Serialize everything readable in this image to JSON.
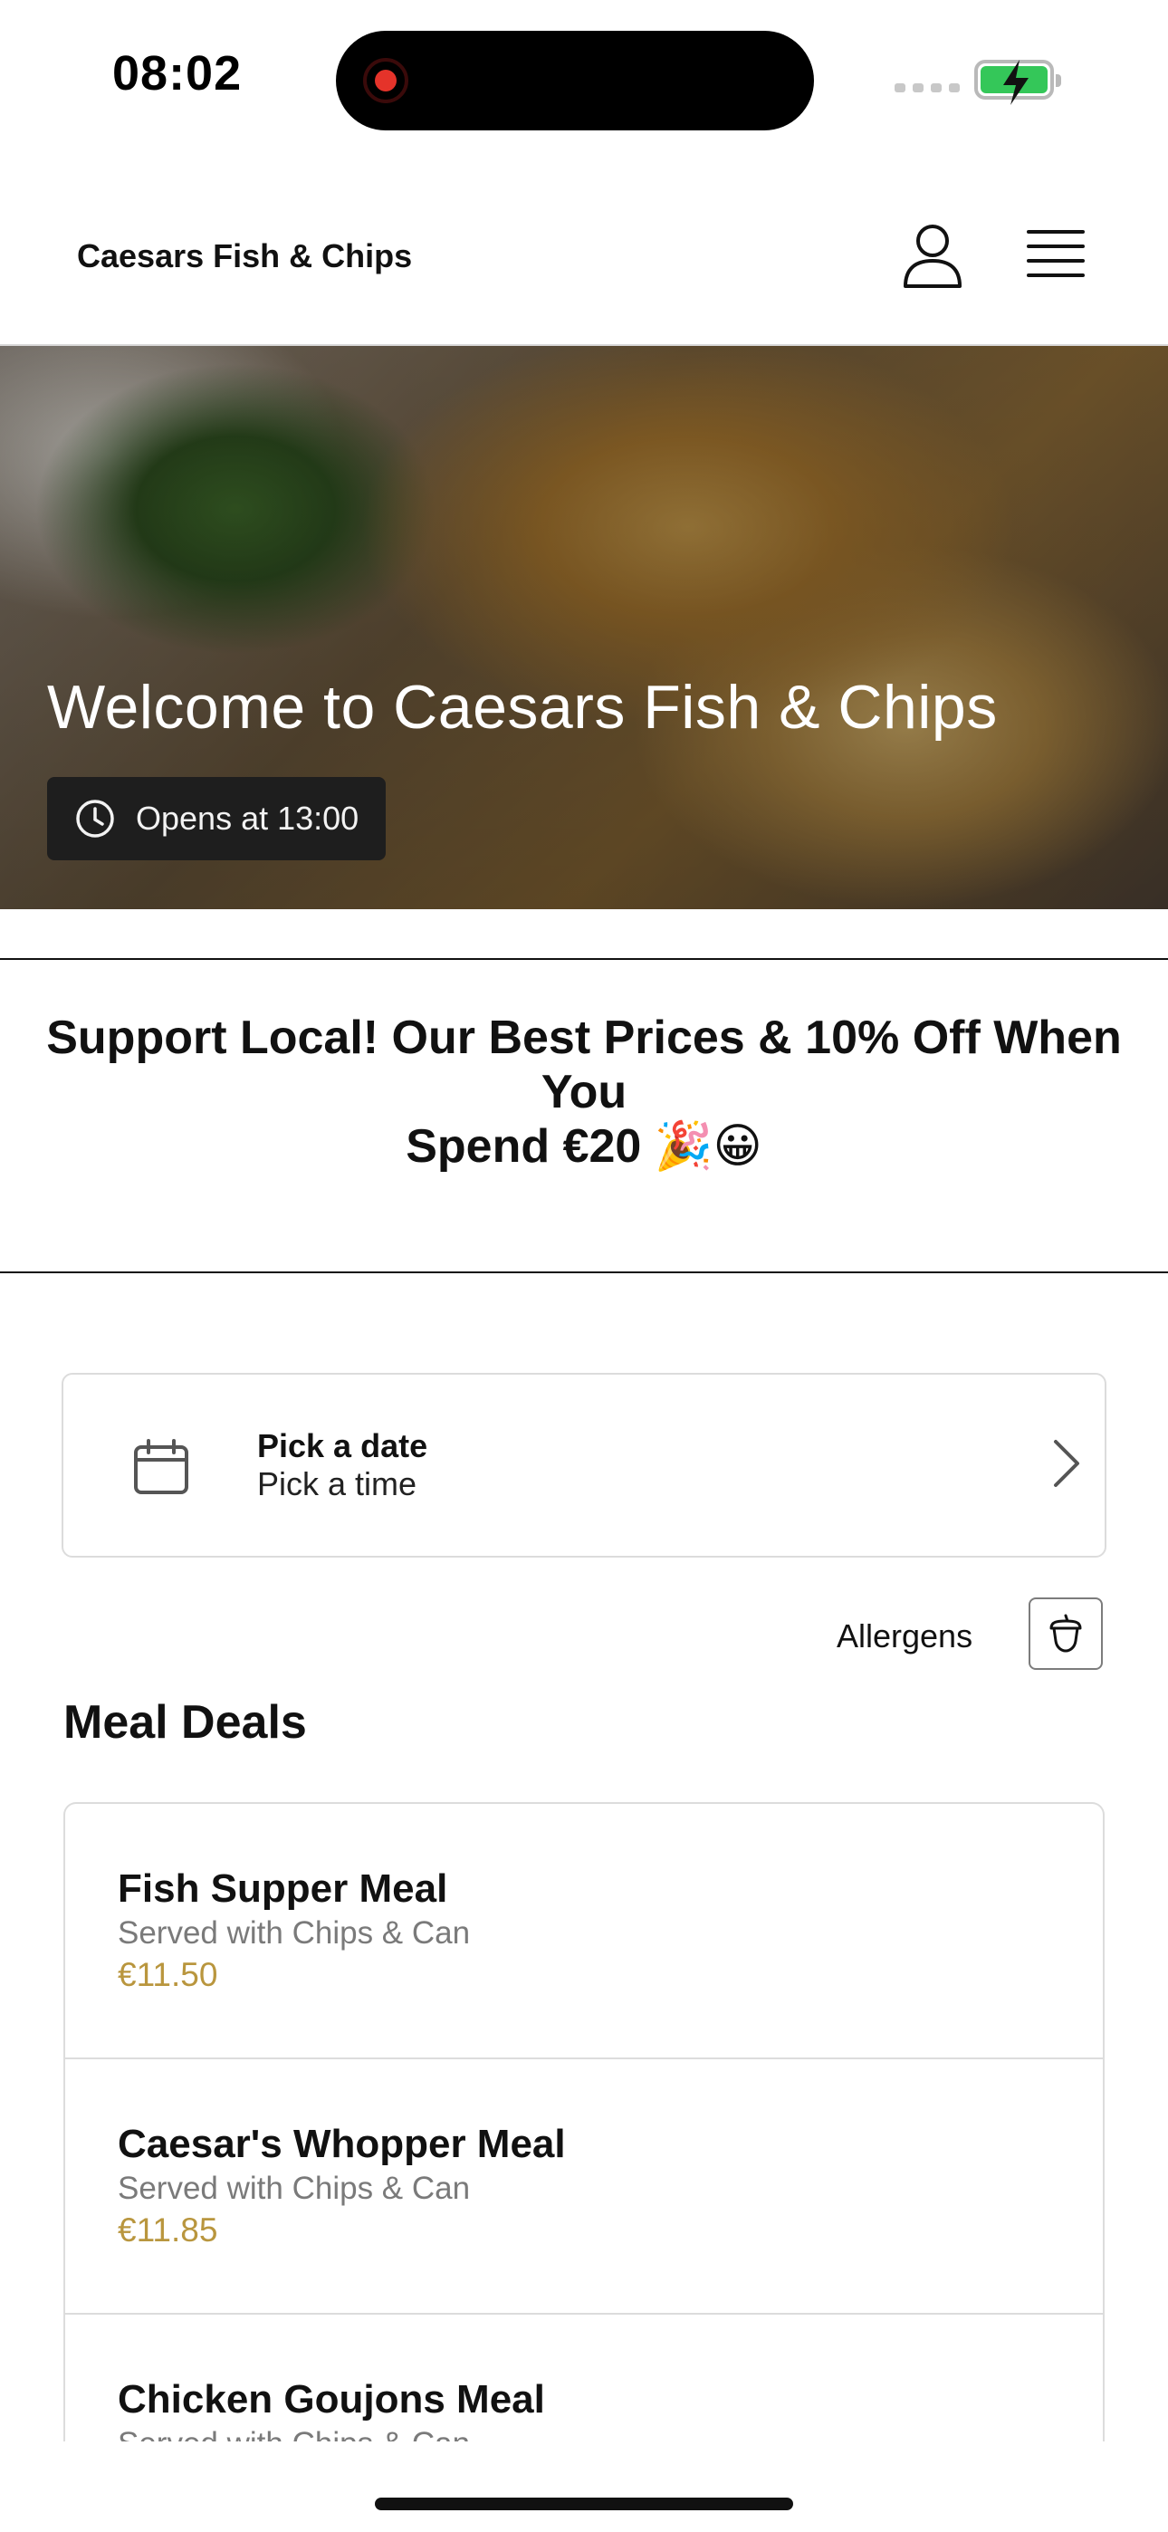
{
  "status_bar": {
    "time": "08:02"
  },
  "header": {
    "title": "Caesars Fish & Chips",
    "icons": [
      "profile-icon",
      "hamburger-menu-icon"
    ]
  },
  "hero": {
    "title": "Welcome to Caesars Fish & Chips",
    "hours": "Opens at 13:00",
    "hours_icon": "clock-icon"
  },
  "promo": {
    "line1": "Support Local! Our Best Prices & 10% Off When You",
    "line2": "Spend €20 🎉😀"
  },
  "schedule": {
    "date_label": "Pick a date",
    "time_label": "Pick a time",
    "icon": "calendar-icon"
  },
  "allergens": {
    "label": "Allergens",
    "icon": "acorn-icon"
  },
  "menu": {
    "section_title": "Meal Deals",
    "accent_price_color": "#b9963e",
    "items": [
      {
        "name": "Fish Supper Meal",
        "description": "Served with Chips & Can",
        "price": "€11.50"
      },
      {
        "name": "Caesar's Whopper Meal",
        "description": "Served with Chips & Can",
        "price": "€11.85"
      },
      {
        "name": "Chicken Goujons Meal",
        "description": "Served with Chips & Can",
        "price": ""
      }
    ]
  }
}
